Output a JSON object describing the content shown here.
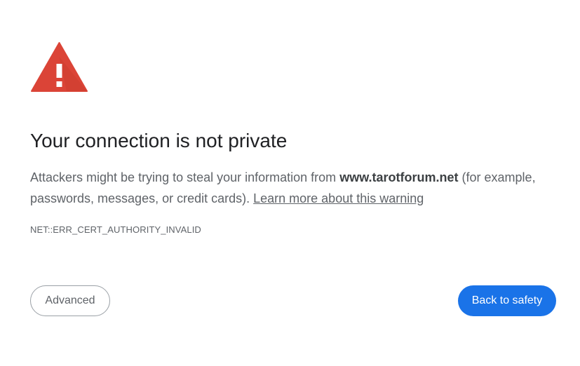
{
  "interstitial": {
    "title": "Your connection is not private",
    "message_prefix": "Attackers might be trying to steal your information from ",
    "host": "www.tarotforum.net",
    "message_suffix": " (for example, passwords, messages, or credit cards). ",
    "learn_more_label": "Learn more about this warning",
    "error_code": "NET::ERR_CERT_AUTHORITY_INVALID"
  },
  "buttons": {
    "advanced_label": "Advanced",
    "back_to_safety_label": "Back to safety"
  },
  "colors": {
    "warning_icon": "#db4437",
    "primary_button": "#1a73e8"
  },
  "icons": {
    "warning": "warning-triangle-icon"
  }
}
